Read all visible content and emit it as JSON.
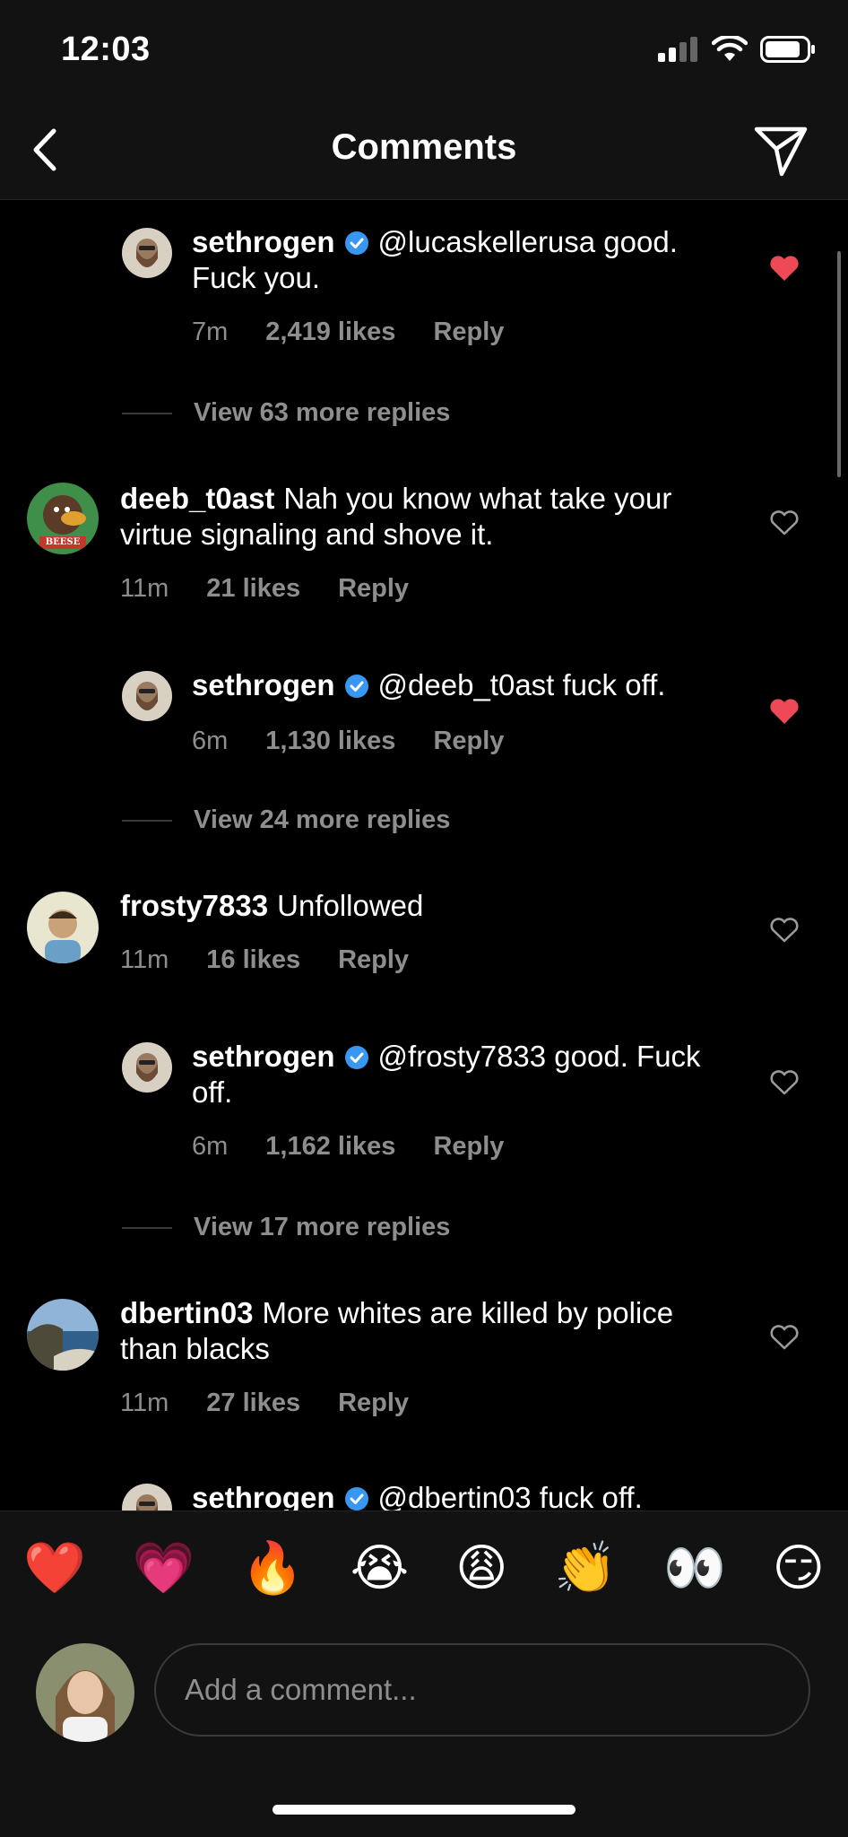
{
  "status": {
    "time": "12:03"
  },
  "header": {
    "title": "Comments"
  },
  "comments": [
    {
      "user": "sethrogen",
      "text": "@lucaskellerusa good. Fuck you.",
      "time": "7m",
      "likes": "2,419 likes",
      "reply": "Reply",
      "liked": true
    },
    {
      "view_more": "View 63 more replies"
    },
    {
      "user": "deeb_t0ast",
      "text": "Nah you know what take your virtue signaling and shove it.",
      "time": "11m",
      "likes": "21 likes",
      "reply": "Reply",
      "liked": false
    },
    {
      "user": "sethrogen",
      "text": "@deeb_t0ast fuck off.",
      "time": "6m",
      "likes": "1,130 likes",
      "reply": "Reply",
      "liked": true
    },
    {
      "view_more": "View 24 more replies"
    },
    {
      "user": "frosty7833",
      "text": "Unfollowed",
      "time": "11m",
      "likes": "16 likes",
      "reply": "Reply",
      "liked": false
    },
    {
      "user": "sethrogen",
      "text": "@frosty7833 good. Fuck off.",
      "time": "6m",
      "likes": "1,162 likes",
      "reply": "Reply",
      "liked": false
    },
    {
      "view_more": "View 17 more replies"
    },
    {
      "user": "dbertin03",
      "text": "More whites are killed by police than blacks",
      "time": "11m",
      "likes": "27 likes",
      "reply": "Reply",
      "liked": false
    },
    {
      "user": "sethrogen",
      "text": "@dbertin03 fuck off."
    }
  ],
  "avatar_badge": "BEESE",
  "emojis": [
    "❤️",
    "💗",
    "🔥",
    "😭",
    "😩",
    "👏",
    "👀",
    "😏"
  ],
  "composer": {
    "placeholder": "Add a comment..."
  },
  "colors": {
    "accent_red": "#ed4956",
    "verified_blue": "#3897f0",
    "bg": "#000000",
    "bar": "#121212"
  }
}
